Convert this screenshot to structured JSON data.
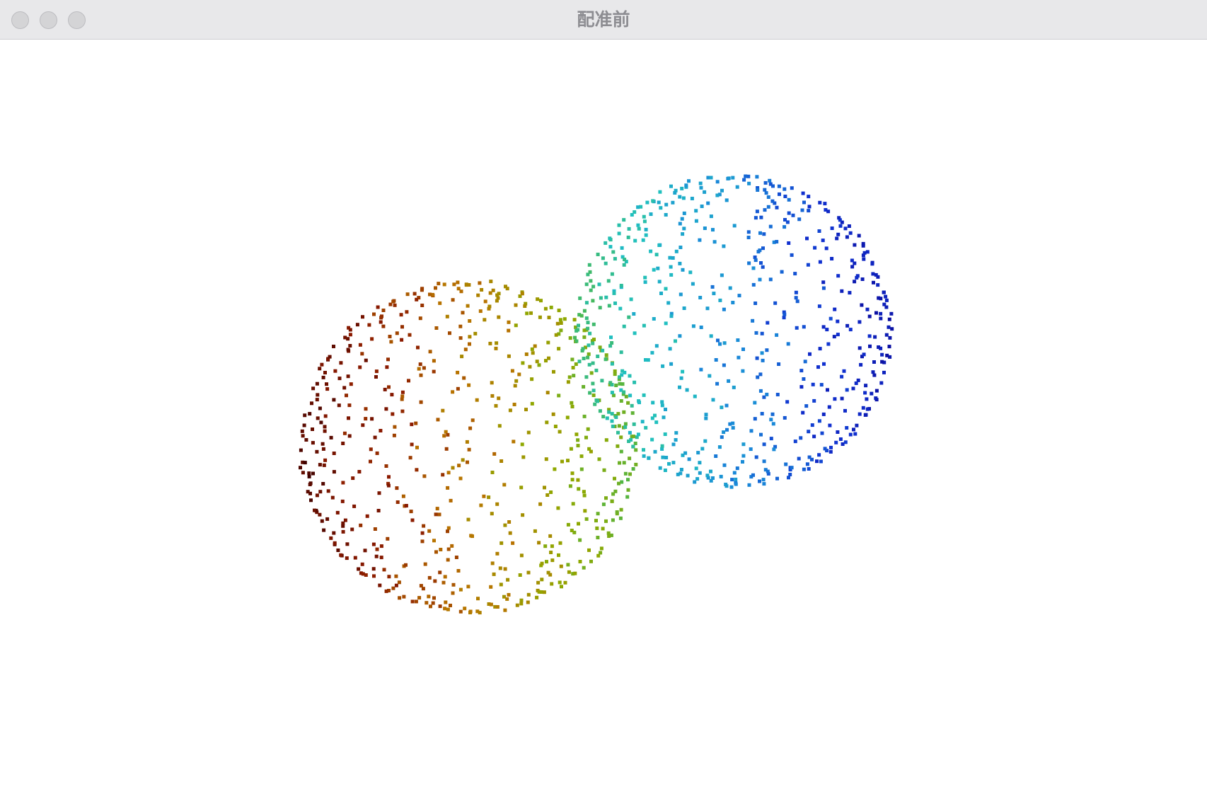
{
  "window": {
    "title": "配准前"
  },
  "scene": {
    "background": "#ffffff",
    "point_clouds": [
      {
        "name": "source-sphere",
        "shape": "sphere-surface",
        "colormap": "jet",
        "color_range": [
          "#3a0000",
          "#8b1a00",
          "#b87400",
          "#8fa800",
          "#4cb84c"
        ],
        "approx_points": 620
      },
      {
        "name": "target-sphere",
        "shape": "sphere-surface",
        "colormap": "jet",
        "color_range": [
          "#4cb84c",
          "#20c0c0",
          "#1a8ad8",
          "#1030d0",
          "#0a0a9a"
        ],
        "approx_points": 620
      }
    ]
  }
}
